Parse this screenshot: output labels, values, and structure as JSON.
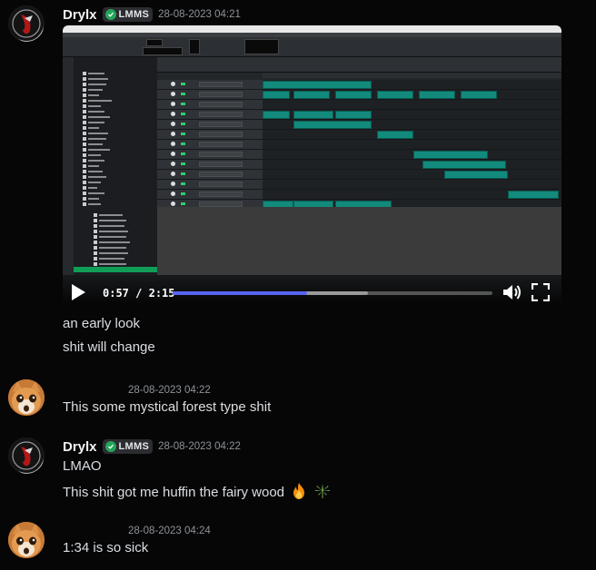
{
  "messages": [
    {
      "author": "Drylx",
      "tag": "LMMS",
      "timestamp": "28-08-2023 04:21",
      "video": {
        "current_time": "0:57",
        "duration": "2:15",
        "progress_percent": 42
      },
      "lines": [
        "an early look",
        "shit will change"
      ]
    },
    {
      "author": "",
      "timestamp": "28-08-2023 04:22",
      "lines": [
        "This some mystical forest type shit"
      ]
    },
    {
      "author": "Drylx",
      "tag": "LMMS",
      "timestamp": "28-08-2023 04:22",
      "lines": [
        "LMAO",
        "This shit got me huffin the fairy wood"
      ],
      "emojis": [
        "fire-emoji",
        "leaf-emoji"
      ]
    },
    {
      "author": "",
      "timestamp": "28-08-2023 04:24",
      "lines": [
        "1:34 is so sick"
      ]
    }
  ],
  "colors": {
    "background": "#060607",
    "username": "#f2f3f5",
    "tag_icon": "#23a55a",
    "timestamp": "#8e9297",
    "progress": "#5865f2",
    "clip": "#128b7d"
  },
  "icons": {
    "tag": "shield-check-icon",
    "play": "play-icon",
    "volume": "volume-icon",
    "fullscreen": "fullscreen-icon"
  }
}
